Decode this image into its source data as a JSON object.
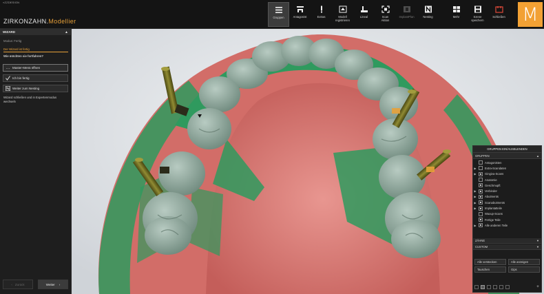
{
  "window": {
    "label": "»ZZDESIGN",
    "brand_main": "ZIRKONZAHN.",
    "brand_sub": "Modellier",
    "logo": "M"
  },
  "toolbar_main": [
    {
      "label": "Gruppen",
      "icon": "menu-lines-icon",
      "active": true
    },
    {
      "label": "Antagonist",
      "icon": "antagonist-icon"
    },
    {
      "label": "Extras",
      "icon": "exclamation-icon"
    },
    {
      "label": "Modell\nregistrieren",
      "icon": "register-model-icon"
    },
    {
      "label": "Lineal",
      "icon": "ruler-icon"
    },
    {
      "label": "Scan\nAktion",
      "icon": "scan-action-icon"
    },
    {
      "label": "ImplantPlan",
      "icon": "implant-plan-icon",
      "disabled": true
    },
    {
      "label": "Nesting",
      "icon": "nesting-icon"
    }
  ],
  "toolbar_right": [
    {
      "label": "Mehr",
      "icon": "more-icon"
    },
    {
      "label": "Szene\nspeichern",
      "icon": "save-scene-icon"
    },
    {
      "label": "Schließen",
      "icon": "close-window-icon"
    }
  ],
  "wizard": {
    "title": "WIZARD",
    "mode": "Modus: Fertig",
    "done": "Der Wizard ist fertig",
    "question": "Wie möchten sie fortfahren?",
    "btn_master": "Master-Menü öffnen",
    "btn_finish": "Ich bin fertig",
    "btn_continue": "Weiter zum Nesting",
    "note": "Wizard schließen und in Expertenmodus wechseln",
    "back": "Zurück",
    "next": "Weiter"
  },
  "groups": {
    "title": "GRUPPEN EIN/AUSBLENDEN",
    "section_groups": "GRUPPEN",
    "section_teeth": "ZÄHNE",
    "section_custom": "CUSTOM",
    "items": [
      {
        "label": "Antagonisten",
        "arrow": false,
        "checked": false,
        "sub": true
      },
      {
        "label": "Extra-Scandaten",
        "arrow": true,
        "checked": false
      },
      {
        "label": "Gingiva-Scans",
        "arrow": true,
        "checked": true
      },
      {
        "label": "Anatomie",
        "arrow": false,
        "checked": false,
        "sub": true
      },
      {
        "label": "Geschmupft",
        "arrow": false,
        "checked": true,
        "sub": true
      },
      {
        "label": "Verbinder",
        "arrow": true,
        "checked": true
      },
      {
        "label": "Abutments",
        "arrow": true,
        "checked": true
      },
      {
        "label": "Scanabutments",
        "arrow": true,
        "checked": true
      },
      {
        "label": "Implantatteile",
        "arrow": true,
        "checked": true
      },
      {
        "label": "Waxup-Scans",
        "arrow": false,
        "checked": false,
        "sub": true
      },
      {
        "label": "Fertige Teile",
        "arrow": false,
        "checked": true,
        "sub": true
      },
      {
        "label": "Alle anderen Teile",
        "arrow": true,
        "checked": true
      }
    ],
    "btn_hide_all": "Alle verstecken",
    "btn_show_all": "Alle anzeigen",
    "btn_invert": "Tauschen",
    "btn_gips": "Gips"
  },
  "colors": {
    "accent": "#e8a13a",
    "gum": "#d9706c",
    "gingiva_scan": "#2f9a5e",
    "crown": "#8fa89d",
    "implant": "#6e6a22"
  }
}
